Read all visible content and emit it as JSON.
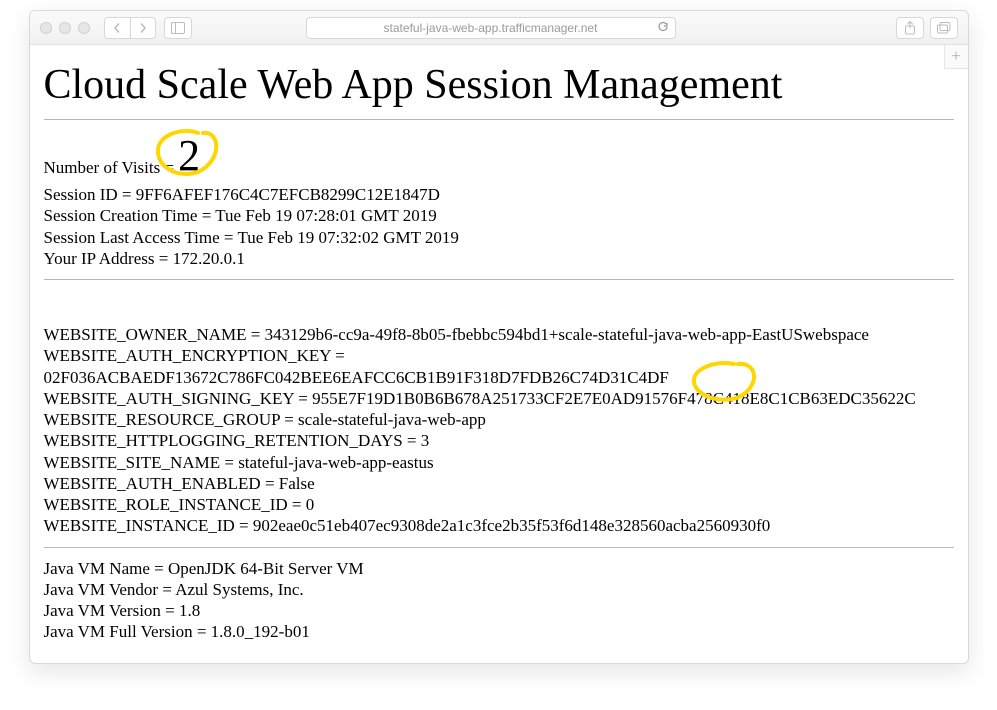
{
  "browser": {
    "url": "stateful-java-web-app.trafficmanager.net"
  },
  "page": {
    "title": "Cloud Scale Web App Session Management",
    "visits_label": "Number of Visits = ",
    "visits_value": "2",
    "session": {
      "id_label": "Session ID = ",
      "id": "9FF6AFEF176C4C7EFCB8299C12E1847D",
      "created_label": "Session Creation Time = ",
      "created": "Tue Feb 19 07:28:01 GMT 2019",
      "last_label": "Session Last Access Time = ",
      "last": "Tue Feb 19 07:32:02 GMT 2019",
      "ip_label": "Your IP Address = ",
      "ip": "172.20.0.1"
    },
    "env": {
      "owner_label": "WEBSITE_OWNER_NAME = ",
      "owner": "343129b6-cc9a-49f8-8b05-fbebbc594bd1+scale-stateful-java-web-app-EastUSwebspace",
      "encrypt_label": "WEBSITE_AUTH_ENCRYPTION_KEY = ",
      "encrypt": "02F036ACBAEDF13672C786FC042BEE6EAFCC6CB1B91F318D7FDB26C74D31C4DF",
      "sign_label": "WEBSITE_AUTH_SIGNING_KEY = ",
      "sign": "955E7F19D1B0B6B678A251733CF2E7E0AD91576F478C418E8C1CB63EDC35622C",
      "rg_label": "WEBSITE_RESOURCE_GROUP = ",
      "rg": "scale-stateful-java-web-app",
      "log_label": "WEBSITE_HTTPLOGGING_RETENTION_DAYS = ",
      "log": "3",
      "site_label": "WEBSITE_SITE_NAME = ",
      "site": "stateful-java-web-app-eastus",
      "auth_label": "WEBSITE_AUTH_ENABLED = ",
      "auth": "False",
      "role_label": "WEBSITE_ROLE_INSTANCE_ID = ",
      "role": "0",
      "inst_label": "WEBSITE_INSTANCE_ID = ",
      "inst": "902eae0c51eb407ec9308de2a1c3fce2b35f53f6d148e328560acba2560930f0"
    },
    "jvm": {
      "name_label": "Java VM Name = ",
      "name": "OpenJDK 64-Bit Server VM",
      "vendor_label": "Java VM Vendor = ",
      "vendor": "Azul Systems, Inc.",
      "ver_label": "Java VM Version = ",
      "ver": "1.8",
      "full_label": "Java VM Full Version = ",
      "full": "1.8.0_192-b01"
    }
  }
}
